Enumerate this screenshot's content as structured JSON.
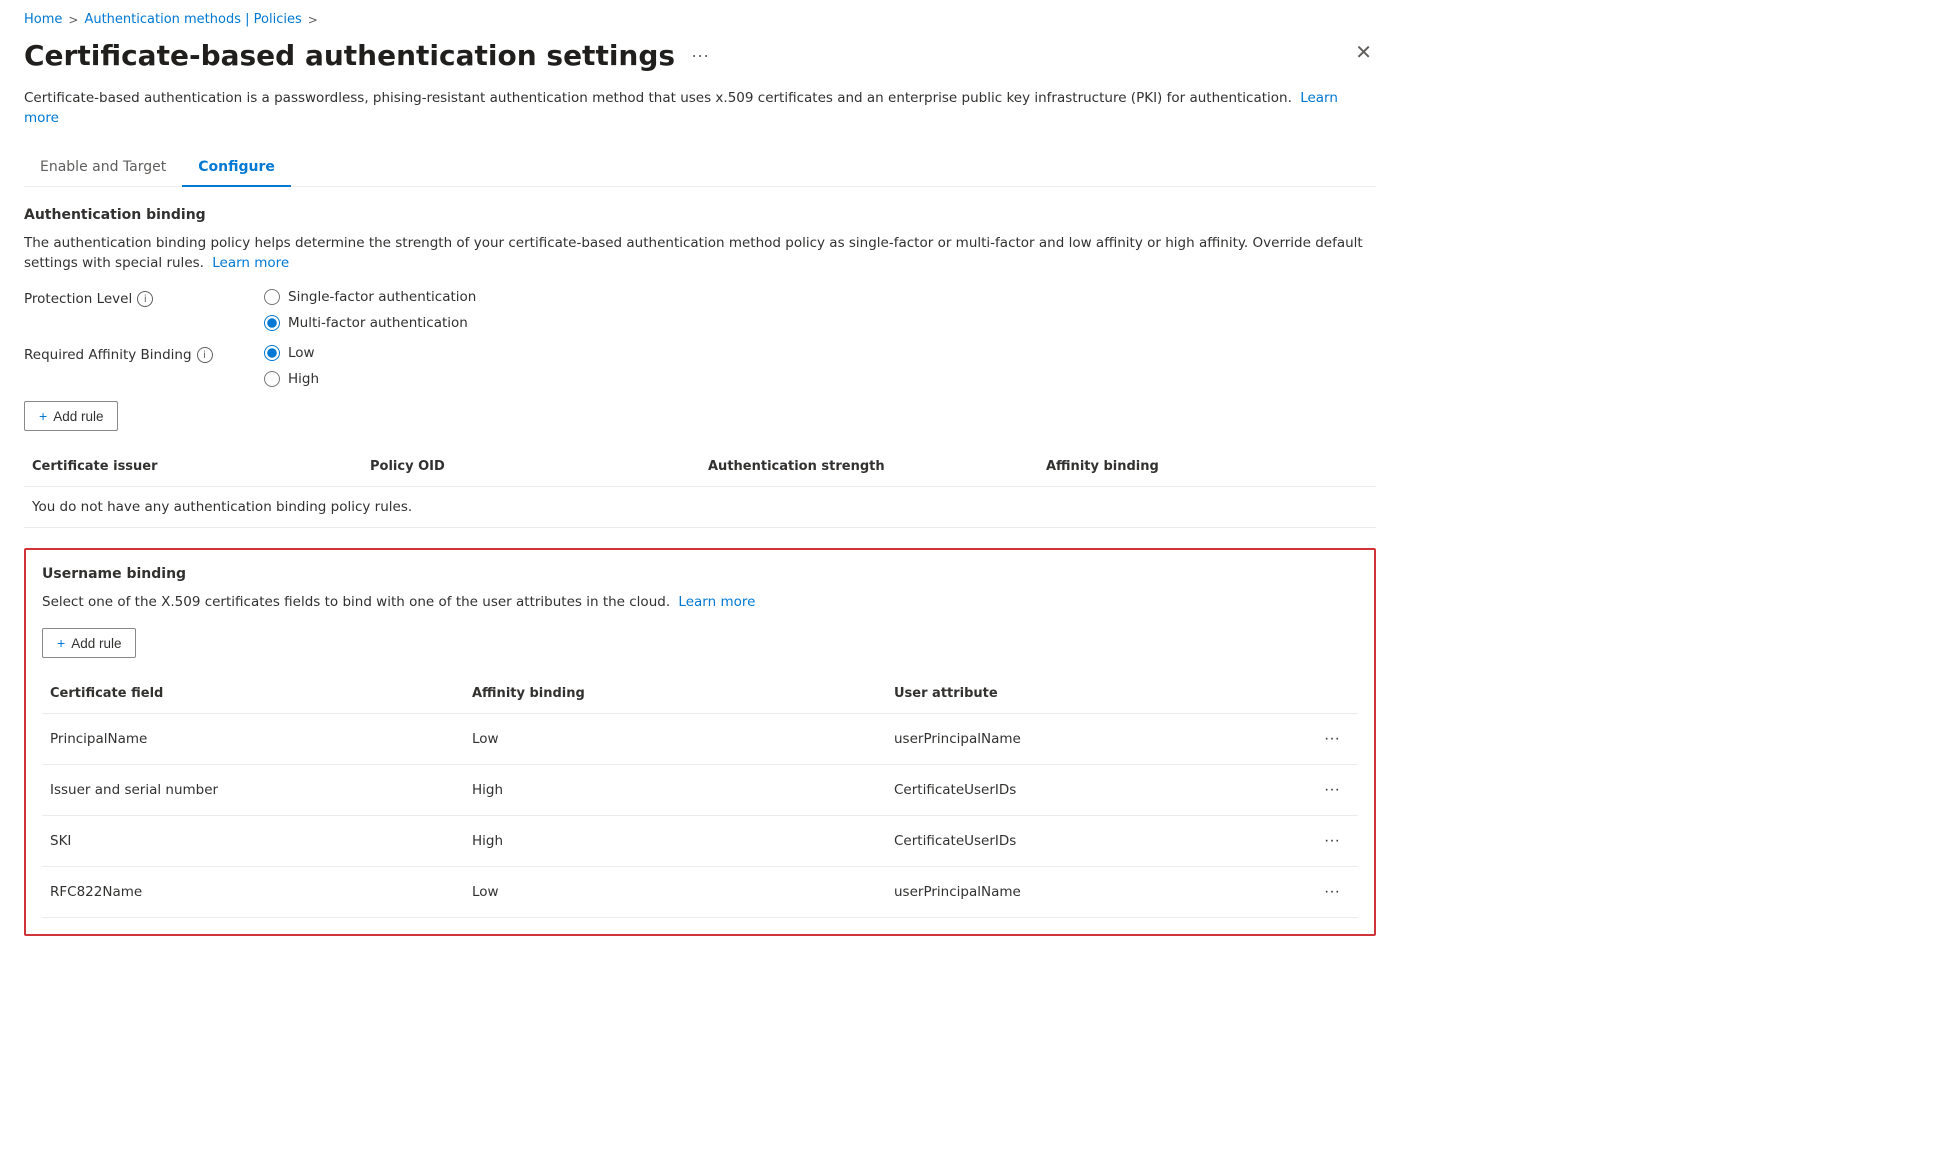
{
  "breadcrumb": {
    "home": "Home",
    "separator1": ">",
    "auth_methods": "Authentication methods | Policies",
    "separator2": ">"
  },
  "page": {
    "title": "Certificate-based authentication settings",
    "description": "Certificate-based authentication is a passwordless, phising-resistant authentication method that uses x.509 certificates and an enterprise public key infrastructure (PKI) for authentication.",
    "learn_more": "Learn more",
    "learn_more_url": "#"
  },
  "tabs": [
    {
      "id": "enable-target",
      "label": "Enable and Target",
      "active": false
    },
    {
      "id": "configure",
      "label": "Configure",
      "active": true
    }
  ],
  "auth_binding": {
    "section_title": "Authentication binding",
    "description": "The authentication binding policy helps determine the strength of your certificate-based authentication method policy as single-factor or multi-factor and low affinity or high affinity. Override default settings with special rules.",
    "learn_more": "Learn more",
    "protection_level": {
      "label": "Protection Level",
      "options": [
        {
          "id": "single-factor",
          "label": "Single-factor authentication",
          "checked": false
        },
        {
          "id": "multi-factor",
          "label": "Multi-factor authentication",
          "checked": true
        }
      ]
    },
    "affinity_binding": {
      "label": "Required Affinity Binding",
      "options": [
        {
          "id": "low",
          "label": "Low",
          "checked": true
        },
        {
          "id": "high",
          "label": "High",
          "checked": false
        }
      ]
    },
    "add_rule_btn": "+ Add rule",
    "table": {
      "columns": [
        "Certificate issuer",
        "Policy OID",
        "Authentication strength",
        "Affinity binding"
      ],
      "empty_message": "You do not have any authentication binding policy rules."
    }
  },
  "username_binding": {
    "section_title": "Username binding",
    "description": "Select one of the X.509 certificates fields to bind with one of the user attributes in the cloud.",
    "learn_more": "Learn more",
    "add_rule_btn": "+ Add rule",
    "table": {
      "columns": [
        "Certificate field",
        "Affinity binding",
        "User attribute",
        ""
      ],
      "rows": [
        {
          "cert_field": "PrincipalName",
          "affinity": "Low",
          "user_attr": "userPrincipalName"
        },
        {
          "cert_field": "Issuer and serial number",
          "affinity": "High",
          "user_attr": "CertificateUserIDs"
        },
        {
          "cert_field": "SKI",
          "affinity": "High",
          "user_attr": "CertificateUserIDs"
        },
        {
          "cert_field": "RFC822Name",
          "affinity": "Low",
          "user_attr": "userPrincipalName"
        }
      ]
    }
  },
  "icons": {
    "plus": "+",
    "ellipsis": "···",
    "close": "✕",
    "more": "···",
    "info": "i",
    "chevron_right": "›"
  }
}
